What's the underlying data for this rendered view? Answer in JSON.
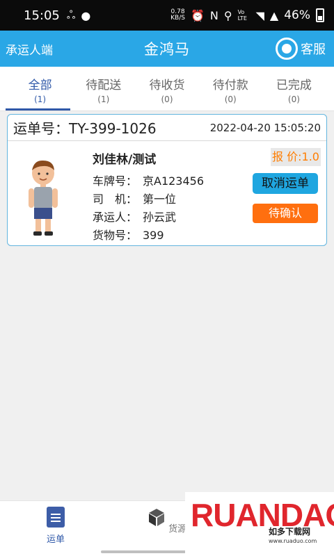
{
  "status_bar": {
    "time": "15:05",
    "net_speed": "0.78",
    "net_unit": "KB/S",
    "signal_label": "4G",
    "volte_label": "Vo LTE",
    "battery": "46%"
  },
  "header": {
    "left_label": "承运人端",
    "title": "金鸿马",
    "service_label": "客服"
  },
  "tabs": [
    {
      "label": "全部",
      "count": "(1)",
      "active": true
    },
    {
      "label": "待配送",
      "count": "(1)",
      "active": false
    },
    {
      "label": "待收货",
      "count": "(0)",
      "active": false
    },
    {
      "label": "待付款",
      "count": "(0)",
      "active": false
    },
    {
      "label": "已完成",
      "count": "(0)",
      "active": false
    }
  ],
  "order": {
    "number_label": "运单号：",
    "number": "TY-399-1026",
    "datetime": "2022-04-20 15:05:20",
    "name": "刘佳林/测试",
    "plate_label": "车牌号：",
    "plate": "京A123456",
    "driver_label": "司　机：",
    "driver": "第一位",
    "carrier_label": "承运人：",
    "carrier": "孙云武",
    "goods_label": "货物号：",
    "goods": "399",
    "quote": "报 价:1.0",
    "cancel_label": "取消运单",
    "status_label": "待确认"
  },
  "bottom_nav": [
    {
      "label": "运单",
      "icon": "document-icon",
      "active": true
    },
    {
      "label": "货源",
      "icon": "box-icon",
      "active": false
    }
  ],
  "watermark": {
    "brand": "RUANDAO",
    "tagline": "如多下载网",
    "url": "www.ruaduo.com"
  },
  "colors": {
    "header_bg": "#2aa7e6",
    "active_tab": "#2f58a8",
    "card_border": "#61b4de",
    "quote_text": "#ff7d00",
    "cancel_bg": "#1fa6e0",
    "pending_bg": "#ff6f0f"
  }
}
